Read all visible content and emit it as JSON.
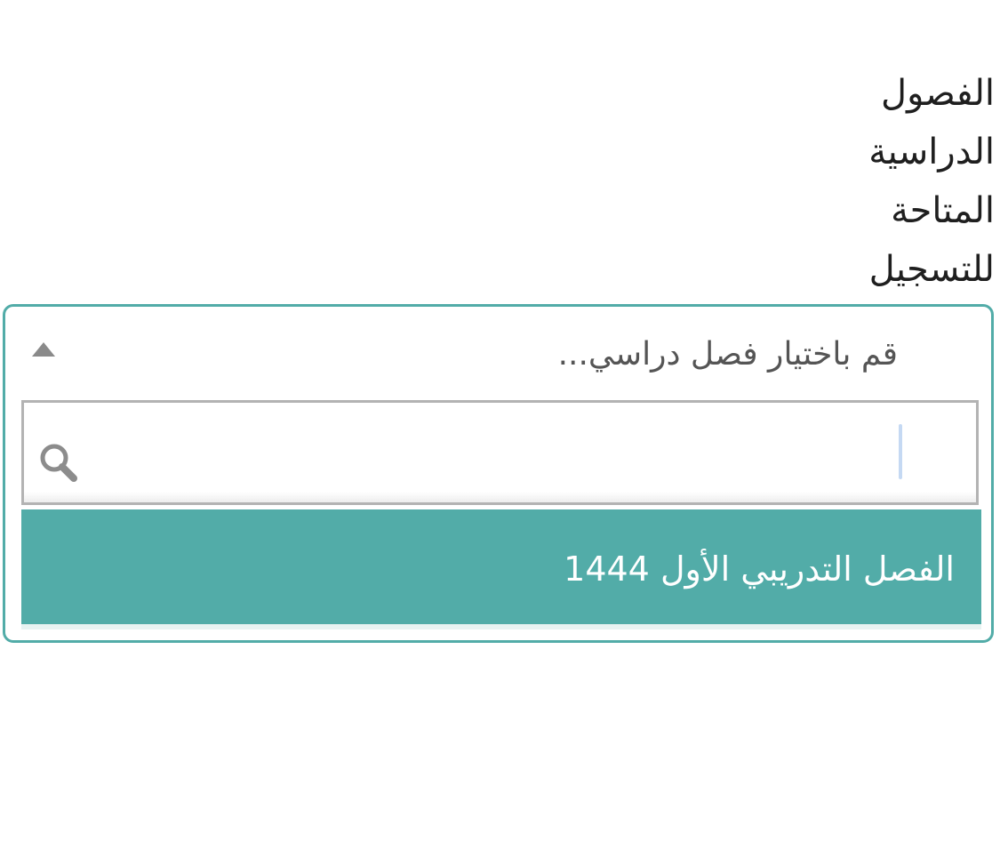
{
  "field": {
    "label_lines": [
      "الفصول",
      "الدراسية",
      "المتاحة",
      "للتسجيل"
    ]
  },
  "select": {
    "placeholder": "قم باختيار فصل دراسي...",
    "caret_icon": "caret-up-icon",
    "search": {
      "value": "",
      "placeholder": "",
      "icon": "search-icon"
    },
    "options": [
      {
        "label": "الفصل التدريبي الأول 1444",
        "highlighted": true
      }
    ]
  },
  "colors": {
    "accent": "#52aca8",
    "border_gray": "#b3b3b3",
    "text": "#1f1f1f",
    "placeholder": "#555555",
    "option_text": "#ffffff"
  }
}
